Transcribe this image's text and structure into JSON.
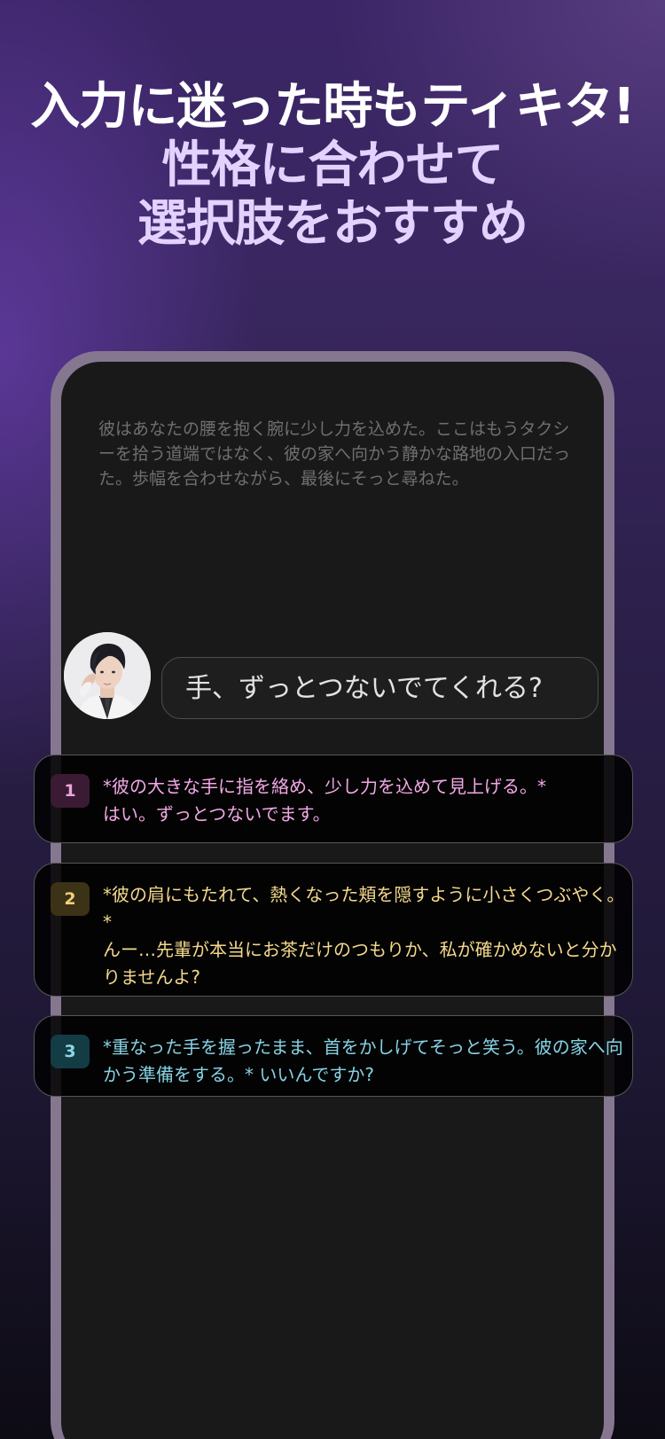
{
  "headline": {
    "line1": "入力に迷った時もティキタ!",
    "line2": "性格に合わせて",
    "line3": "選択肢をおすすめ"
  },
  "chat": {
    "narration": "彼はあなたの腰を抱く腕に少し力を込めた。ここはもうタクシーを拾う道端ではなく、彼の家へ向かう静かな路地の入口だった。歩幅を合わせながら、最後にそっと尋ねた。",
    "character_line": "手、ずっとつないでてくれる?"
  },
  "choices": [
    {
      "number": "1",
      "line1": "*彼の大きな手に指を絡め、少し力を込めて見上げる。*",
      "line2": "はい。ずっとつないでます。",
      "color": "#f3a8e5"
    },
    {
      "number": "2",
      "line1": "*彼の肩にもたれて、熱くなった頬を隠すように小さくつぶやく。*",
      "line2": "んー…先輩が本当にお茶だけのつもりか、私が確かめないと分かりませんよ?",
      "color": "#f4d98c"
    },
    {
      "number": "3",
      "line1": "*重なった手を握ったまま、首をかしげてそっと笑う。彼の家へ向かう準備をする。* いいんですか?",
      "color": "#86d3e5"
    }
  ]
}
